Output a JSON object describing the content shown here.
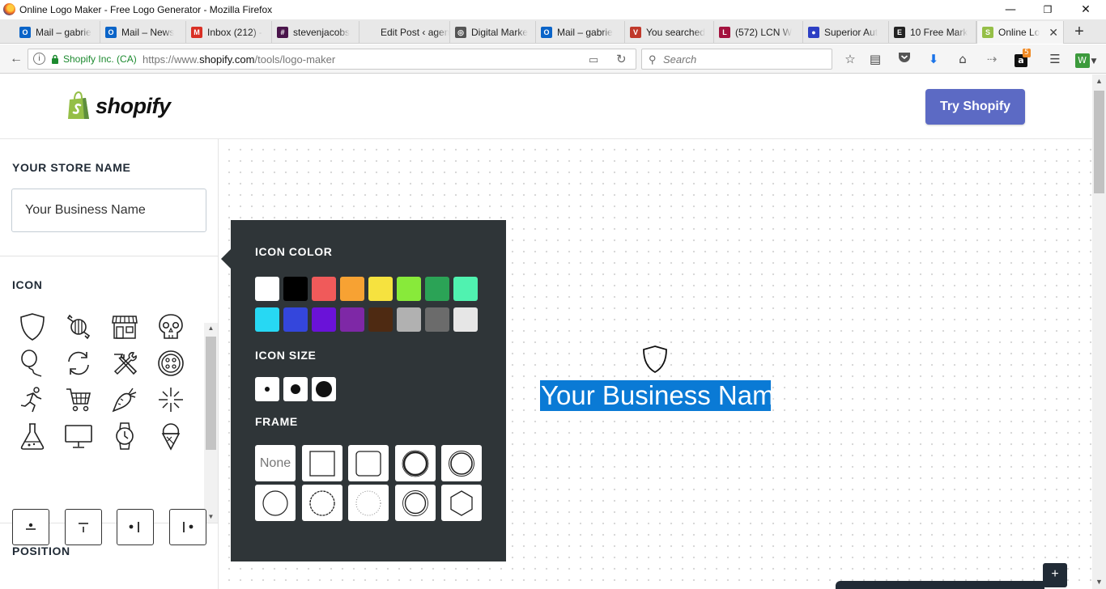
{
  "window": {
    "title": "Online Logo Maker - Free Logo Generator - Mozilla Firefox",
    "minimize": "—",
    "restore": "❐",
    "close": "✕"
  },
  "tabs": [
    {
      "label": "Mail – gabrie",
      "favicon_color": "#0a64c8",
      "favicon_text": "O"
    },
    {
      "label": "Mail – News",
      "favicon_color": "#0a64c8",
      "favicon_text": "O"
    },
    {
      "label": "Inbox (212) -",
      "favicon_color": "#d93025",
      "favicon_text": "M"
    },
    {
      "label": "stevenjacobs",
      "favicon_color": "#4a154b",
      "favicon_text": "#"
    },
    {
      "label": "Edit Post ‹ agenty",
      "favicon_color": "#e8e8e8",
      "favicon_text": ""
    },
    {
      "label": "Digital Marke",
      "favicon_color": "#555555",
      "favicon_text": "◎"
    },
    {
      "label": "Mail – gabrie",
      "favicon_color": "#0a64c8",
      "favicon_text": "O"
    },
    {
      "label": "You searched",
      "favicon_color": "#c0392b",
      "favicon_text": "V"
    },
    {
      "label": "(572) LCN W",
      "favicon_color": "#a3123e",
      "favicon_text": "L"
    },
    {
      "label": "Superior Aut",
      "favicon_color": "#2d3fc4",
      "favicon_text": "●"
    },
    {
      "label": "10 Free Mark",
      "favicon_color": "#222222",
      "favicon_text": "E"
    },
    {
      "label": "Online Lo",
      "favicon_color": "#95bf47",
      "favicon_text": "S"
    }
  ],
  "newtab_label": "+",
  "navbar": {
    "company": "Shopify Inc. (CA)",
    "url_prefix": "https://www.",
    "url_domain": "shopify.com",
    "url_path": "/tools/logo-maker",
    "search_placeholder": "Search",
    "amazon_badge": "5"
  },
  "header": {
    "brand": "shopify",
    "cta_label": "Try Shopify",
    "cta_color": "#5c6ac4"
  },
  "sidebar": {
    "store_name_title": "YOUR STORE NAME",
    "store_name_value": "Your Business Name",
    "icon_title": "ICON",
    "icons": [
      "shield-icon",
      "candy-icon",
      "storefront-icon",
      "skull-icon",
      "balloon-icon",
      "refresh-cycle-icon",
      "tools-icon",
      "button-icon",
      "runner-icon",
      "shopping-cart-icon",
      "carrot-icon",
      "sparkle-icon",
      "flask-icon",
      "monitor-icon",
      "watch-icon",
      "ice-cream-icon"
    ],
    "position_title": "POSITION",
    "positions": [
      "icon-above-text",
      "icon-above-text-alt",
      "icon-left-of-text",
      "icon-left-bar-text"
    ]
  },
  "popover": {
    "color_title": "ICON COLOR",
    "colors": [
      "#ffffff",
      "#000000",
      "#f05a5a",
      "#f7a233",
      "#f6e23f",
      "#88ea3a",
      "#2ba356",
      "#50f2b0",
      "#27d8f3",
      "#3446dc",
      "#6a12d8",
      "#7e28a6",
      "#4e2a12",
      "#b1b1b1",
      "#6b6b6b",
      "#e6e6e6"
    ],
    "size_title": "ICON SIZE",
    "sizes": [
      "small",
      "medium",
      "large"
    ],
    "frame_title": "FRAME",
    "frame_none_label": "None",
    "frames": [
      "none",
      "square",
      "rounded-square",
      "circle-thick",
      "circle-double",
      "circle",
      "circle-scalloped",
      "circle-dotted",
      "circle-ring",
      "hexagon"
    ]
  },
  "preview": {
    "business_name": "Your Business Name",
    "highlight_color": "#0a7ad5"
  },
  "tray_button_label": "+"
}
